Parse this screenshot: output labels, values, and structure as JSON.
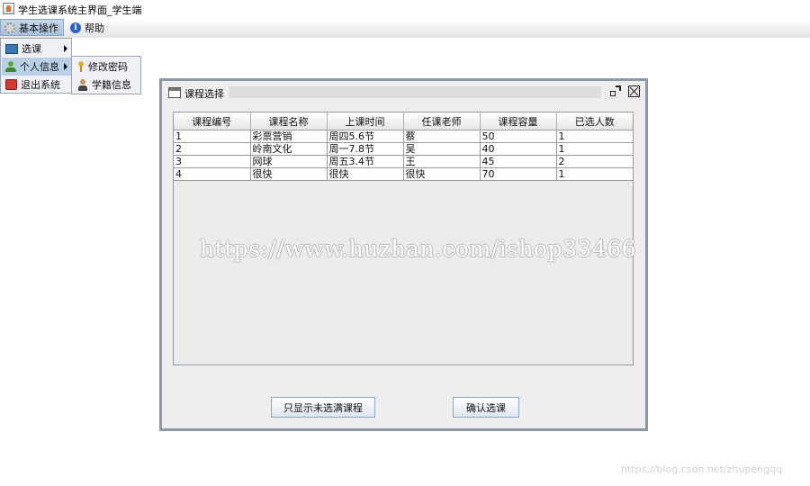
{
  "window": {
    "title": "学生选课系统主界面_学生端"
  },
  "menubar": {
    "basic_ops": "基本操作",
    "help": "帮助"
  },
  "popup": {
    "items": [
      {
        "label": "选课"
      },
      {
        "label": "个人信息"
      },
      {
        "label": "退出系统"
      }
    ],
    "submenu": [
      {
        "label": "修改密码"
      },
      {
        "label": "学籍信息"
      }
    ]
  },
  "frame": {
    "title": "课程选择"
  },
  "table": {
    "columns": [
      "课程编号",
      "课程名称",
      "上课时间",
      "任课老师",
      "课程容量",
      "已选人数"
    ],
    "rows": [
      [
        "1",
        "彩票营销",
        "周四5.6节",
        "蔡",
        "50",
        "1"
      ],
      [
        "2",
        "岭南文化",
        "周一7.8节",
        "吴",
        "40",
        "1"
      ],
      [
        "3",
        "网球",
        "周五3.4节",
        "王",
        "45",
        "2"
      ],
      [
        "4",
        "很快",
        "很快",
        "很快",
        "70",
        "1"
      ]
    ]
  },
  "watermark": "https://www.huzhan.com/ishop33466",
  "buttons": {
    "filter": "只显示未选满课程",
    "confirm": "确认选课"
  },
  "credit": "https://blog.csdn.net/zhupengqq"
}
